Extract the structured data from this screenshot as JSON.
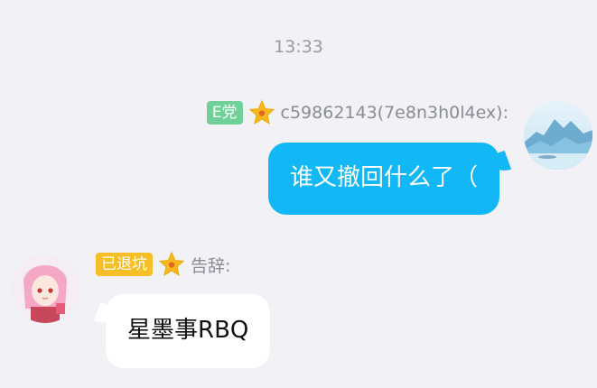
{
  "timestamp": "13:33",
  "messages": [
    {
      "direction": "outgoing",
      "badge": {
        "label": "E党",
        "color": "#6fd098"
      },
      "rank_icon": "star-rank-icon",
      "sender": "c59862143(7e8n3h0l4ex):",
      "text": "谁又撤回什么了（",
      "bubble_color": "#12b7f5",
      "avatar_icon": "landscape-avatar"
    },
    {
      "direction": "incoming",
      "badge": {
        "label": "已退坑",
        "color": "#f6bf28"
      },
      "rank_icon": "star-rank-icon",
      "sender": "告辞:",
      "text": "星墨事RBQ",
      "bubble_color": "#ffffff",
      "avatar_icon": "anime-girl-avatar"
    }
  ],
  "colors": {
    "background": "#f1f1f6",
    "meta_text": "#8b8b94",
    "star": "#f7b91e"
  }
}
